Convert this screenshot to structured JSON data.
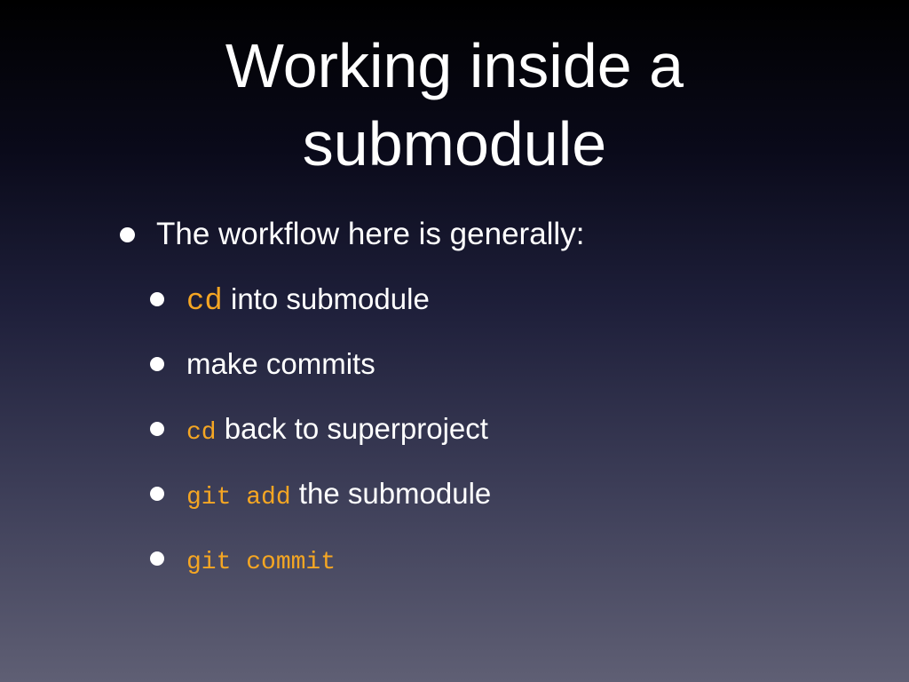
{
  "slide": {
    "title_line1": "Working inside a",
    "title_line2": "submodule",
    "bullet": "The workflow here is generally:",
    "steps": [
      {
        "code": "cd",
        "text": " into submodule"
      },
      {
        "code": "",
        "text": "make commits"
      },
      {
        "code": "cd",
        "text": " back to superproject"
      },
      {
        "code": "git add",
        "text": " the submodule"
      },
      {
        "code": "git commit",
        "text": ""
      }
    ]
  },
  "colors": {
    "code": "#f5a623",
    "text": "#ffffff",
    "background_top": "#000000",
    "background_bottom": "#5f5f74"
  }
}
